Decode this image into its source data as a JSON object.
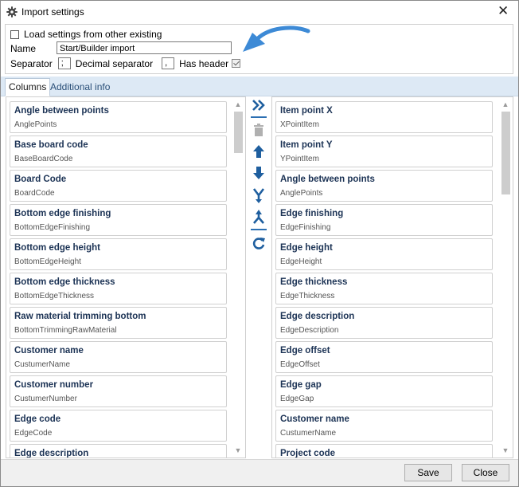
{
  "window": {
    "title": "Import settings",
    "icon": "gear-icon",
    "close_glyph": "✕"
  },
  "settings": {
    "load_label": "Load settings from other existing",
    "load_checked": false,
    "name_label": "Name",
    "name_value": "Start/Builder import",
    "separator_label": "Separator",
    "separator_value": ";",
    "decimal_label": "Decimal separator",
    "decimal_value": ",",
    "header_label": "Has header",
    "header_checked": true
  },
  "tabs": [
    {
      "label": "Columns",
      "active": true
    },
    {
      "label": "Additional info",
      "active": false
    }
  ],
  "left_list": [
    {
      "label": "Angle between points",
      "code": "AnglePoints"
    },
    {
      "label": "Base board code",
      "code": "BaseBoardCode"
    },
    {
      "label": "Board Code",
      "code": "BoardCode"
    },
    {
      "label": "Bottom edge finishing",
      "code": "BottomEdgeFinishing"
    },
    {
      "label": "Bottom edge height",
      "code": "BottomEdgeHeight"
    },
    {
      "label": "Bottom edge thickness",
      "code": "BottomEdgeThickness"
    },
    {
      "label": "Raw material trimming bottom",
      "code": "BottomTrimmingRawMaterial"
    },
    {
      "label": "Customer name",
      "code": "CustumerName"
    },
    {
      "label": "Customer number",
      "code": "CustumerNumber"
    },
    {
      "label": "Edge code",
      "code": "EdgeCode"
    },
    {
      "label": "Edge description",
      "code": ""
    }
  ],
  "right_list": [
    {
      "label": "Item point X",
      "code": "XPointItem"
    },
    {
      "label": "Item point Y",
      "code": "YPointItem"
    },
    {
      "label": "Angle between points",
      "code": "AnglePoints"
    },
    {
      "label": "Edge finishing",
      "code": "EdgeFinishing"
    },
    {
      "label": "Edge height",
      "code": "EdgeHeight"
    },
    {
      "label": "Edge thickness",
      "code": "EdgeThickness"
    },
    {
      "label": "Edge description",
      "code": "EdgeDescription"
    },
    {
      "label": "Edge offset",
      "code": "EdgeOffset"
    },
    {
      "label": "Edge gap",
      "code": "EdgeGap"
    },
    {
      "label": "Customer name",
      "code": "CustumerName"
    },
    {
      "label": "Project code",
      "code": ""
    }
  ],
  "middle_buttons": [
    {
      "name": "move-all-right-icon"
    },
    {
      "name": "delete-icon"
    },
    {
      "name": "move-up-icon"
    },
    {
      "name": "move-down-icon"
    },
    {
      "name": "merge-icon"
    },
    {
      "name": "split-icon"
    },
    {
      "name": "refresh-icon"
    }
  ],
  "footer": {
    "save_label": "Save",
    "close_label": "Close"
  },
  "colors": {
    "accent": "#2b6fb2",
    "tab_bar": "#dde9f5",
    "card_title": "#1c3355",
    "callout_arrow": "#3d8ad6"
  }
}
